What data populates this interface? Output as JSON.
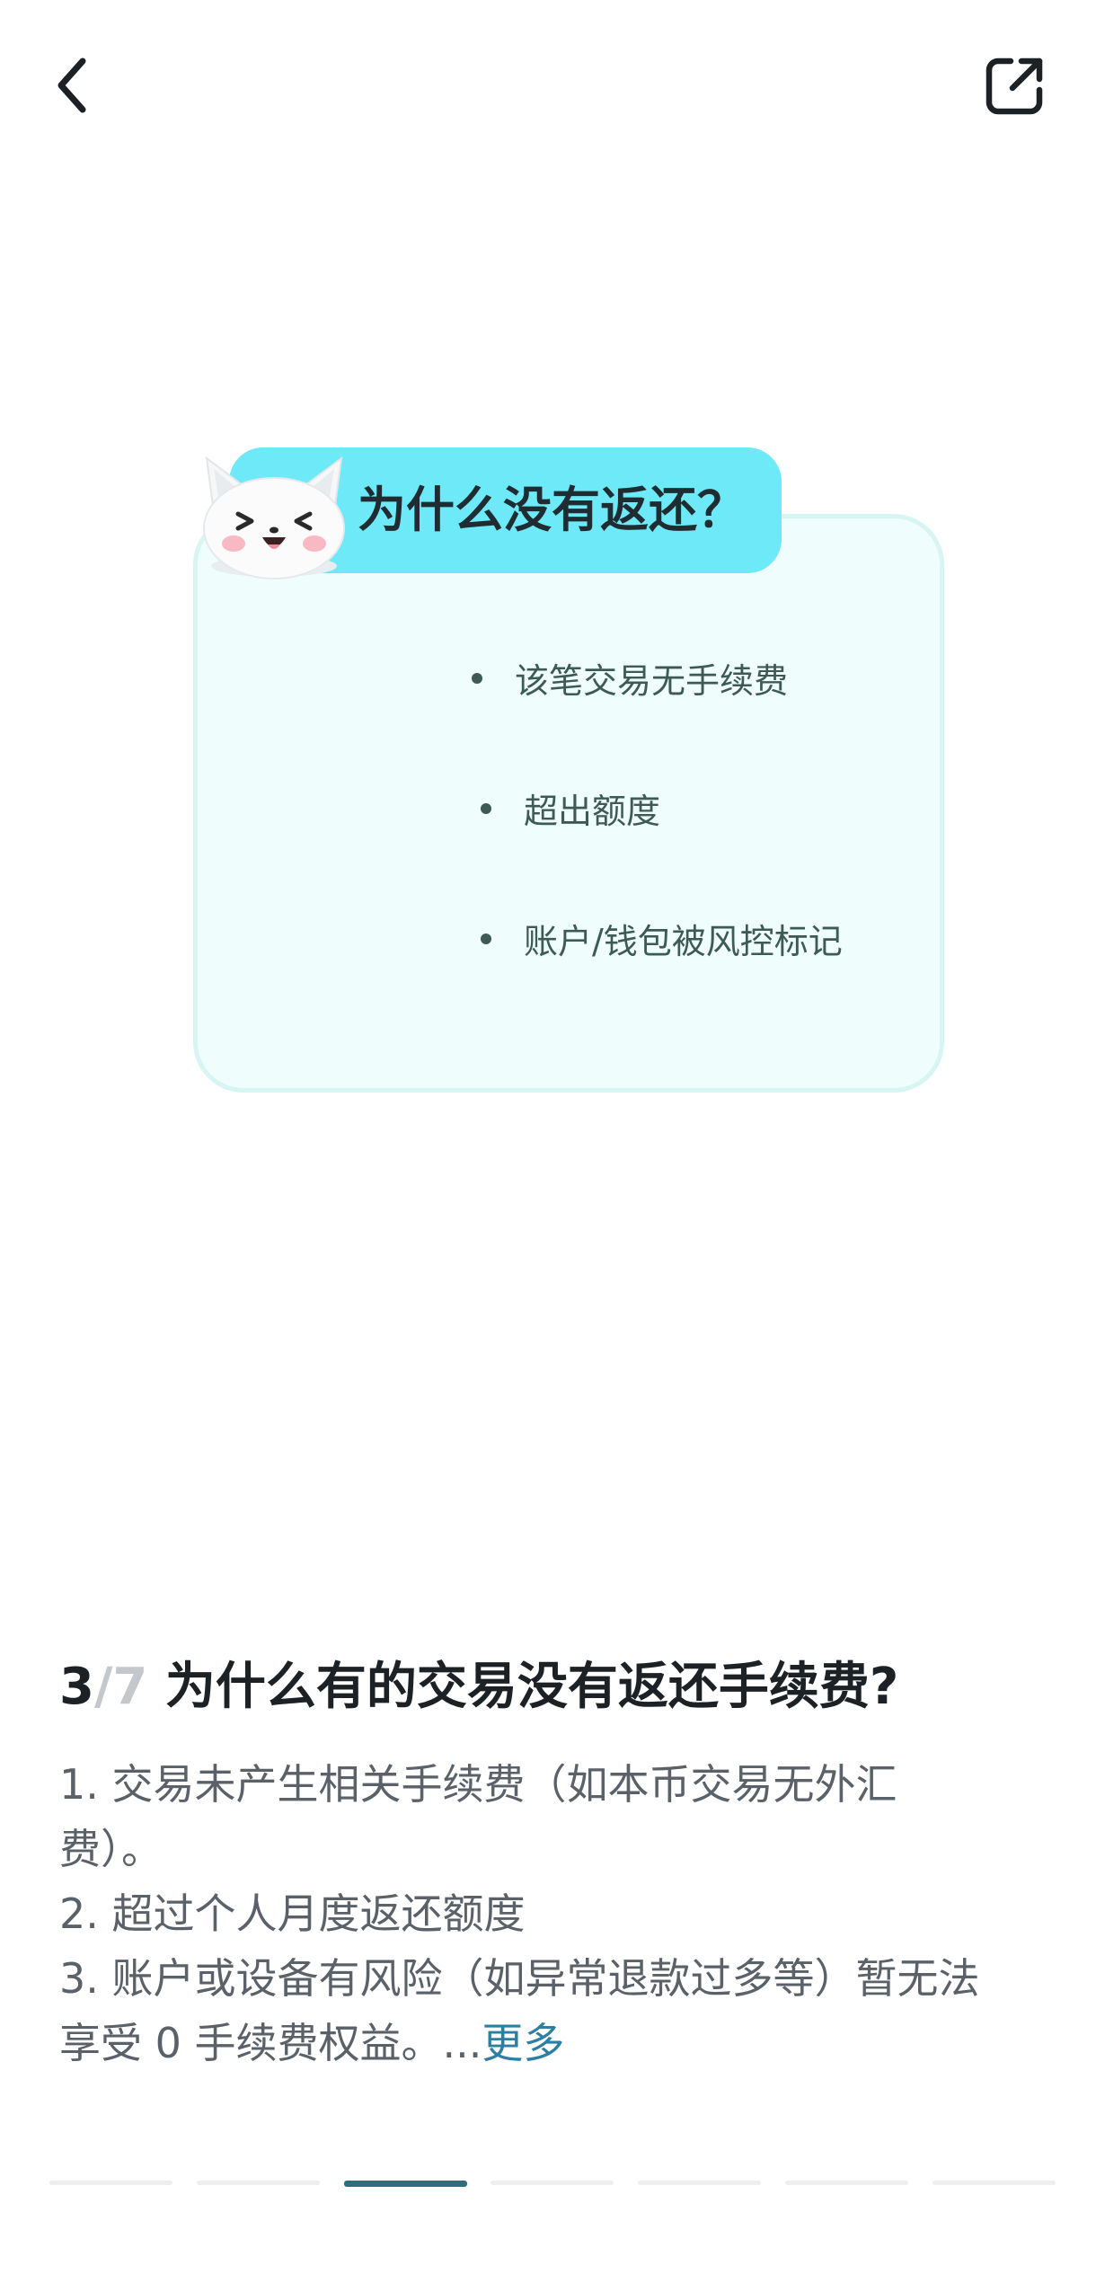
{
  "topbar": {
    "back_icon": "chevron-left-icon",
    "share_icon": "share-external-icon"
  },
  "card": {
    "title": "为什么没有返还？",
    "mascot_icon": "white-cat-mascot",
    "reasons": [
      "该笔交易无手续费",
      "超出额度",
      "账户/钱包被风控标记"
    ],
    "colors": {
      "tab": "#6ee9f7",
      "card_bg": "#f0fdfd",
      "card_border": "#d7f5f2"
    }
  },
  "question": {
    "current": "3",
    "separator_total": "/7",
    "title": "为什么有的交易没有返还手续费?"
  },
  "answer": {
    "lines": [
      "1. 交易未产生相关手续费（如本币交易无外汇",
      "费）。",
      "2. 超过个人月度返还额度",
      "3. 账户或设备有风险（如异常退款过多等）暂无法",
      "享受 0 手续费权益。..."
    ],
    "more_label": "更多"
  },
  "progress": {
    "total": 7,
    "current": 3,
    "active_color": "#2e6e7f"
  }
}
